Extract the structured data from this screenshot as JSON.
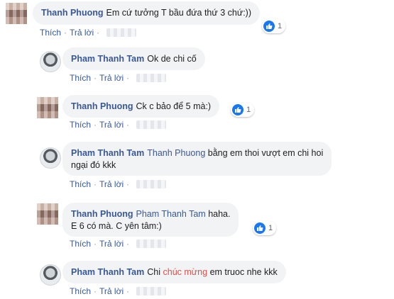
{
  "actions": {
    "like": "Thích",
    "reply": "Trả lời",
    "separator": "·"
  },
  "comments": [
    {
      "author": "Thanh Phuong",
      "text": "Em cứ tưởng T bầu đứa thứ 3 chứ:))",
      "reactions": "1"
    },
    {
      "author": "Pham Thanh Tam",
      "text": "Ok de chi cố"
    },
    {
      "author": "Thanh Phuong",
      "text": "Ck c bảo để 5 mà:)",
      "reactions": "1"
    },
    {
      "author": "Pham Thanh Tam",
      "mention": "Thanh Phuong",
      "line1": "bằng em thoi vượt em chi hoi",
      "line2": "ngại đó kkk"
    },
    {
      "author": "Thanh Phuong",
      "mention": "Pham Thanh Tam",
      "line1": "haha.",
      "line2": "E 6 có mà. C yên tâm:)",
      "reactions": "1"
    },
    {
      "author": "Pham Thanh Tam",
      "pre": "Chi",
      "highlight": "chúc mừng",
      "post": "em truoc nhe kkk"
    }
  ],
  "colors": {
    "link": "#385898",
    "highlight": "#d9534f",
    "like": "#1877f2"
  }
}
